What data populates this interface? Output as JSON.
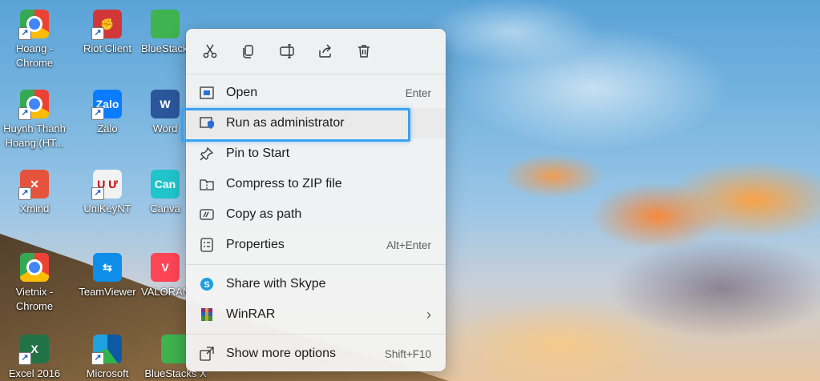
{
  "desktop": {
    "icons": [
      {
        "label": "Hoang - Chrome"
      },
      {
        "label": "Riot Client"
      },
      {
        "label": "BlueStacks"
      },
      {
        "label": "Huynh Thanh Hoang (HT..."
      },
      {
        "label": "Zalo"
      },
      {
        "label": "Word"
      },
      {
        "label": "Xmind"
      },
      {
        "label": "UniKeyNT"
      },
      {
        "label": "Canva"
      },
      {
        "label": "Vietnix - Chrome"
      },
      {
        "label": "TeamViewer"
      },
      {
        "label": "VALORANT"
      },
      {
        "label": "Excel 2016"
      },
      {
        "label": "Microsoft"
      },
      {
        "label": "BlueStacks X"
      }
    ]
  },
  "context_menu": {
    "toolbar": [
      "cut-icon",
      "copy-icon",
      "rename-icon",
      "share-icon",
      "delete-icon"
    ],
    "items": [
      {
        "label": "Open",
        "hint": "Enter",
        "icon": "open-icon"
      },
      {
        "label": "Run as administrator",
        "hint": "",
        "icon": "shield-icon",
        "highlighted": true
      },
      {
        "label": "Pin to Start",
        "hint": "",
        "icon": "pin-icon"
      },
      {
        "label": "Compress to ZIP file",
        "hint": "",
        "icon": "zip-folder-icon"
      },
      {
        "label": "Copy as path",
        "hint": "",
        "icon": "path-icon"
      },
      {
        "label": "Properties",
        "hint": "Alt+Enter",
        "icon": "properties-icon"
      },
      {
        "label": "Share with Skype",
        "hint": "",
        "icon": "skype-icon"
      },
      {
        "label": "WinRAR",
        "hint": "›",
        "icon": "winrar-icon"
      },
      {
        "label": "Show more options",
        "hint": "Shift+F10",
        "icon": "more-options-icon"
      }
    ]
  },
  "colors": {
    "highlight_border": "#3aa0f0",
    "menu_bg": "#f3f3f3"
  }
}
